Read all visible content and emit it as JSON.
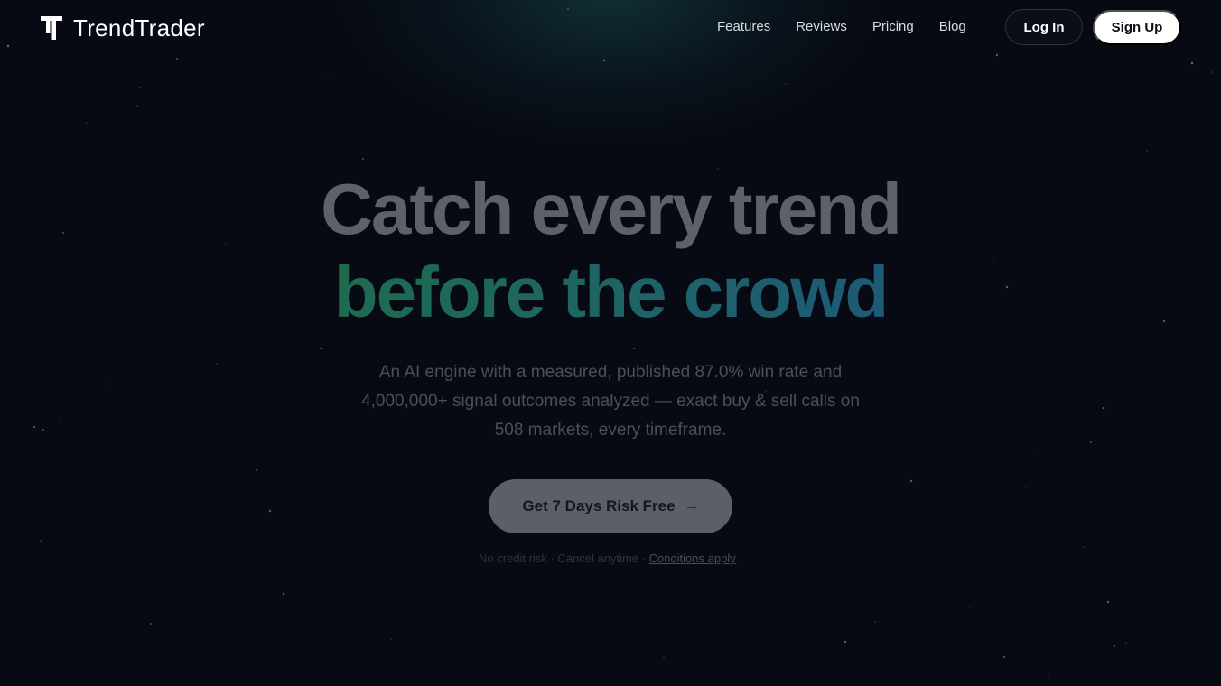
{
  "brand": {
    "name": "TrendTrader",
    "logo_icon": "tt-logo-icon"
  },
  "nav": {
    "links": [
      "Features",
      "Reviews",
      "Pricing",
      "Blog"
    ],
    "login_label": "Log In",
    "signup_label": "Sign Up"
  },
  "hero": {
    "title_line1": "Catch every trend",
    "title_line2": "before the crowd",
    "subtitle_line1": "An AI engine with a measured, published 87.0% win rate and",
    "subtitle_line2": "4,000,000+ signal outcomes analyzed — exact buy & sell calls on",
    "subtitle_line3": "508 markets, every timeframe.",
    "cta_label": "Get 7 Days Risk Free",
    "cta_arrow": "→",
    "fine_print": "No credit risk · Cancel anytime · ",
    "fine_link": "Conditions apply",
    "fine_tail": " ."
  },
  "colors": {
    "background": "#070a12",
    "accent_green": "#1e6b4f",
    "accent_blue": "#1d5a77",
    "title_gray": "#5d616b"
  }
}
